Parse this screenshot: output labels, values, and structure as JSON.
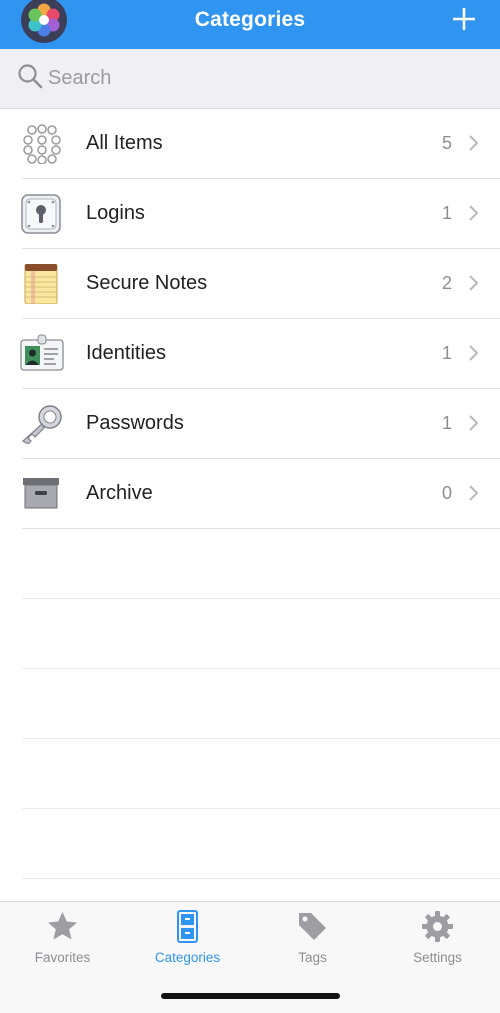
{
  "header": {
    "title": "Categories"
  },
  "search": {
    "placeholder": "Search"
  },
  "categories": [
    {
      "label": "All Items",
      "count": "5",
      "icon": "all-items-icon"
    },
    {
      "label": "Logins",
      "count": "1",
      "icon": "login-icon"
    },
    {
      "label": "Secure Notes",
      "count": "2",
      "icon": "secure-note-icon"
    },
    {
      "label": "Identities",
      "count": "1",
      "icon": "identity-icon"
    },
    {
      "label": "Passwords",
      "count": "1",
      "icon": "key-icon"
    },
    {
      "label": "Archive",
      "count": "0",
      "icon": "archive-box-icon"
    }
  ],
  "tabs": [
    {
      "label": "Favorites",
      "icon": "star-icon",
      "active": false
    },
    {
      "label": "Categories",
      "icon": "file-cabinet-icon",
      "active": true
    },
    {
      "label": "Tags",
      "icon": "tag-icon",
      "active": false
    },
    {
      "label": "Settings",
      "icon": "gear-icon",
      "active": false
    }
  ],
  "colors": {
    "accent": "#2f95f0",
    "inactive": "#8e8e93",
    "background": "#ffffff",
    "search_bg": "#efeff4"
  }
}
